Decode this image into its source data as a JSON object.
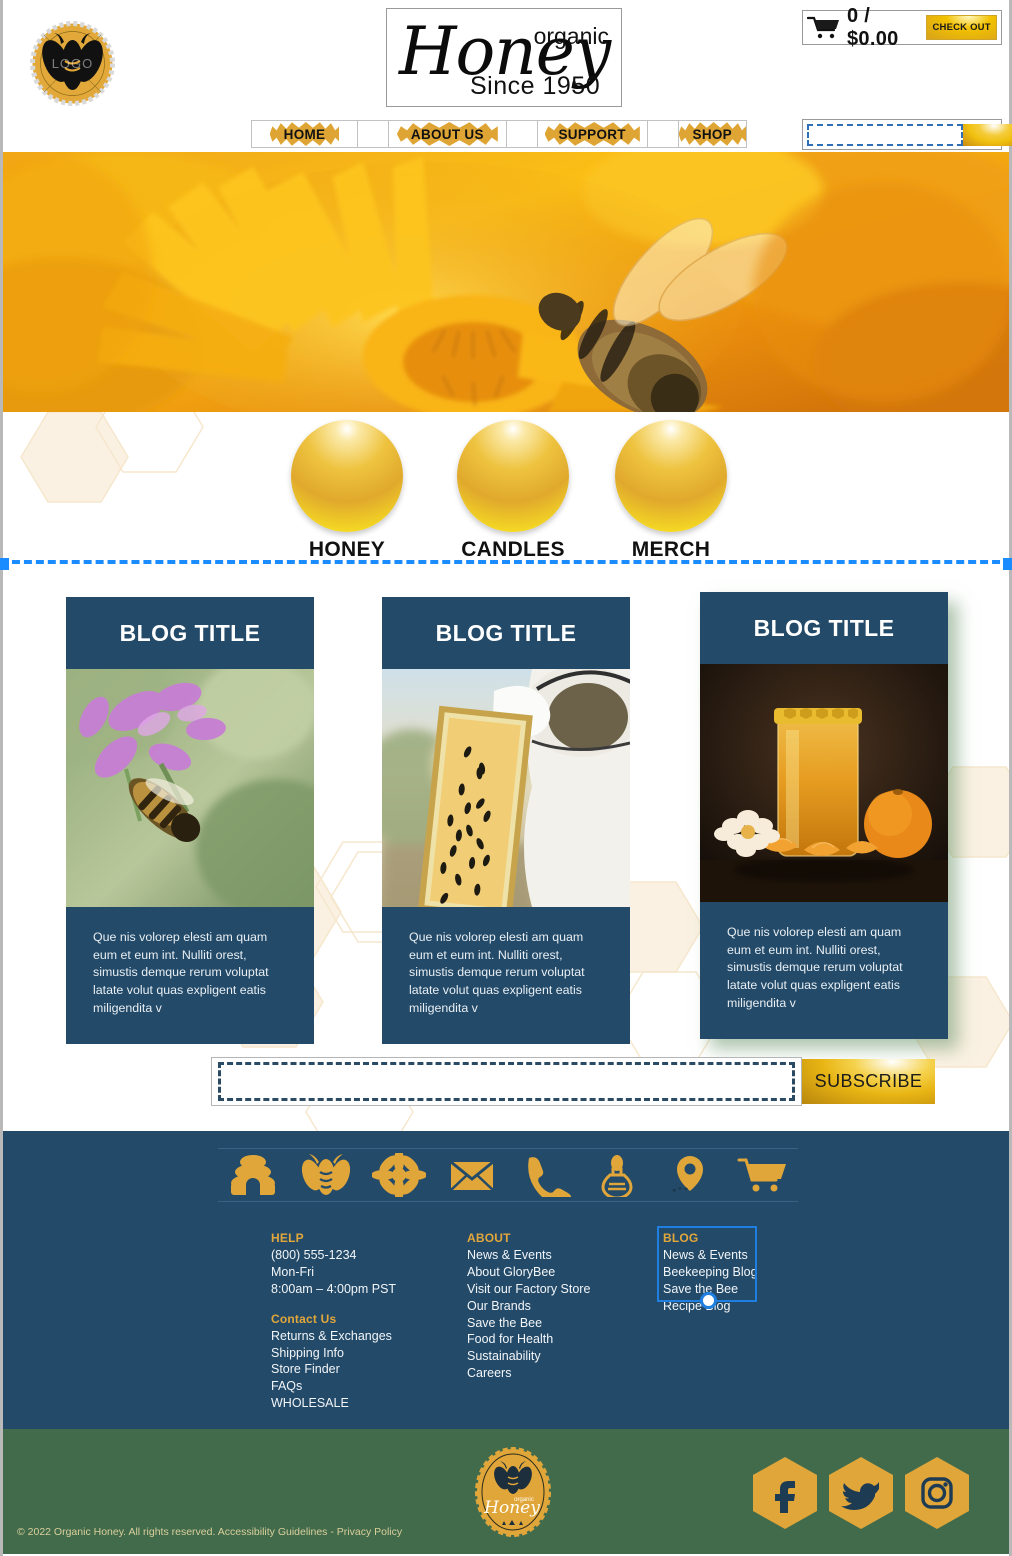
{
  "header": {
    "logo_watermark": "LOGO",
    "brand": {
      "script": "Honey",
      "organic": "organic",
      "since": "Since 1950"
    },
    "cart": {
      "amount": "0 / $0.00",
      "checkout_label": "CHECK OUT"
    },
    "search": {
      "value": "",
      "placeholder": ""
    }
  },
  "nav": {
    "items": [
      {
        "label": "HOME"
      },
      {
        "label": "ABOUT US"
      },
      {
        "label": "SUPPORT"
      },
      {
        "label": "SHOP"
      }
    ]
  },
  "categories": [
    {
      "label": "HONEY"
    },
    {
      "label": "CANDLES"
    },
    {
      "label": "MERCH"
    }
  ],
  "blog_cards": [
    {
      "title": "BLOG TITLE",
      "body": "Que nis volorep elesti am quam eum et eum int. Nulliti orest, simustis demque rerum voluptat latate volut quas expligent eatis miligendita v",
      "image": "bee-on-lavender"
    },
    {
      "title": "BLOG TITLE",
      "body": "Que nis volorep elesti am quam eum et eum int. Nulliti orest, simustis demque rerum voluptat latate volut quas expligent eatis miligendita v",
      "image": "beekeeper-with-frame"
    },
    {
      "title": "BLOG TITLE",
      "body": "Que nis volorep elesti am quam eum et eum int. Nulliti orest, simustis demque rerum voluptat latate volut quas expligent eatis miligendita v",
      "image": "honey-jar-with-oranges"
    }
  ],
  "subscribe": {
    "value": "",
    "placeholder": "",
    "button_label": "SUBSCRIBE"
  },
  "footer": {
    "icons": [
      "beehive-icon",
      "bee-icon",
      "flower-icon",
      "envelope-icon",
      "phone-icon",
      "honey-jar-icon",
      "location-pin-icon",
      "shopping-cart-icon"
    ],
    "columns": [
      {
        "heading": "HELP",
        "lines": [
          "(800) 555-1234",
          "Mon-Fri",
          "8:00am – 4:00pm PST"
        ],
        "subheading": "Contact Us",
        "links": [
          "Returns & Exchanges",
          "Shipping Info",
          "Store Finder",
          "FAQs",
          "WHOLESALE"
        ]
      },
      {
        "heading": "ABOUT",
        "links": [
          "News & Events",
          "About GloryBee",
          "Visit our Factory Store",
          "Our Brands",
          "Save the Bee",
          "Food for Health",
          "Sustainability",
          "Careers"
        ]
      },
      {
        "heading": "BLOG",
        "links": [
          "News & Events",
          "Beekeeping Blog",
          "Save the Bee",
          "Recipe Blog"
        ],
        "selected": true
      }
    ]
  },
  "bottom": {
    "badge_script": "Honey",
    "badge_organic": "organic",
    "socials": [
      "facebook-icon",
      "twitter-icon",
      "instagram-icon"
    ],
    "copyright": "© 2022 Organic Honey. All rights reserved. Accessibility Guidelines - Privacy Policy"
  },
  "colors": {
    "gold": "#dfa534",
    "navy": "#234a68",
    "green": "#426b4c",
    "guide_blue": "#1a8cff",
    "heading_gold": "#e2a73b"
  }
}
